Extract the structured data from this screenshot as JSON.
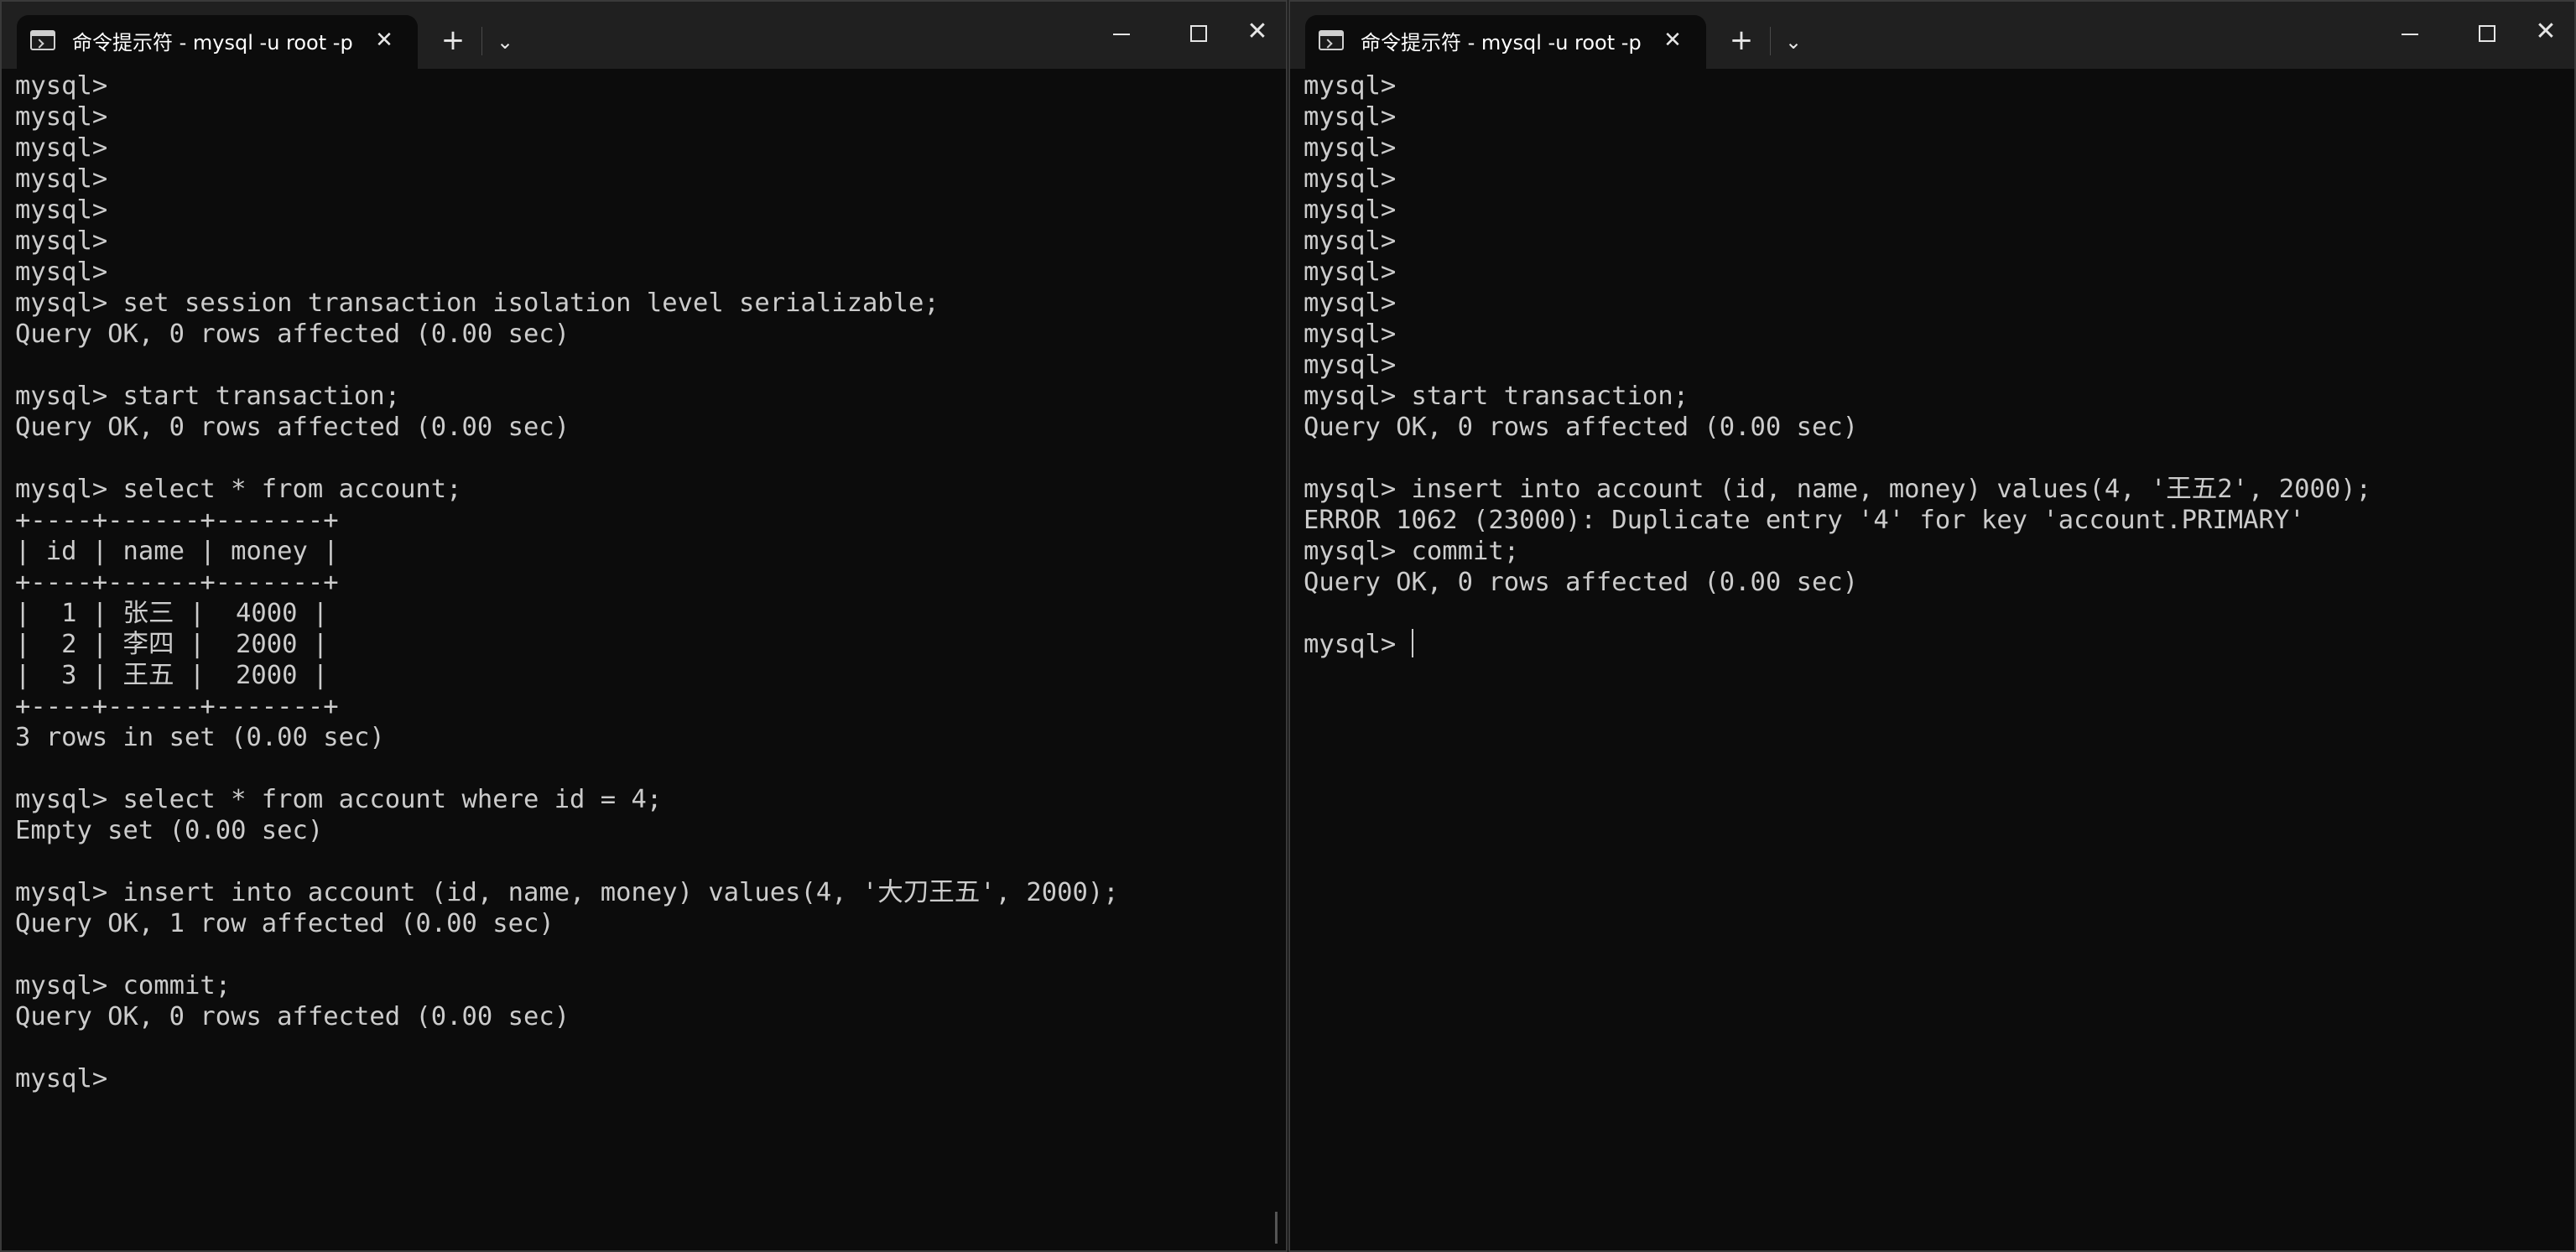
{
  "left_window": {
    "tab_title": "命令提示符 - mysql  -u root -p",
    "tab_close_glyph": "✕",
    "new_tab_glyph": "+",
    "dropdown_glyph": "⌄",
    "close_glyph": "✕",
    "lines": [
      "mysql>",
      "mysql>",
      "mysql>",
      "mysql>",
      "mysql>",
      "mysql>",
      "mysql>",
      "mysql> set session transaction isolation level serializable;",
      "Query OK, 0 rows affected (0.00 sec)",
      "",
      "mysql> start transaction;",
      "Query OK, 0 rows affected (0.00 sec)",
      "",
      "mysql> select * from account;",
      "+----+------+-------+",
      "| id | name | money |",
      "+----+------+-------+",
      "|  1 | 张三 |  4000 |",
      "|  2 | 李四 |  2000 |",
      "|  3 | 王五 |  2000 |",
      "+----+------+-------+",
      "3 rows in set (0.00 sec)",
      "",
      "mysql> select * from account where id = 4;",
      "Empty set (0.00 sec)",
      "",
      "mysql> insert into account (id, name, money) values(4, '大刀王五', 2000);",
      "Query OK, 1 row affected (0.00 sec)",
      "",
      "mysql> commit;",
      "Query OK, 0 rows affected (0.00 sec)",
      "",
      "mysql>"
    ]
  },
  "right_window": {
    "tab_title": "命令提示符 - mysql  -u root -p",
    "tab_close_glyph": "✕",
    "new_tab_glyph": "+",
    "dropdown_glyph": "⌄",
    "close_glyph": "✕",
    "lines": [
      "mysql>",
      "mysql>",
      "mysql>",
      "mysql>",
      "mysql>",
      "mysql>",
      "mysql>",
      "mysql>",
      "mysql>",
      "mysql>",
      "mysql> start transaction;",
      "Query OK, 0 rows affected (0.00 sec)",
      "",
      "mysql> insert into account (id, name, money) values(4, '王五2', 2000);",
      "ERROR 1062 (23000): Duplicate entry '4' for key 'account.PRIMARY'",
      "mysql> commit;",
      "Query OK, 0 rows affected (0.00 sec)",
      "",
      "mysql> "
    ]
  }
}
